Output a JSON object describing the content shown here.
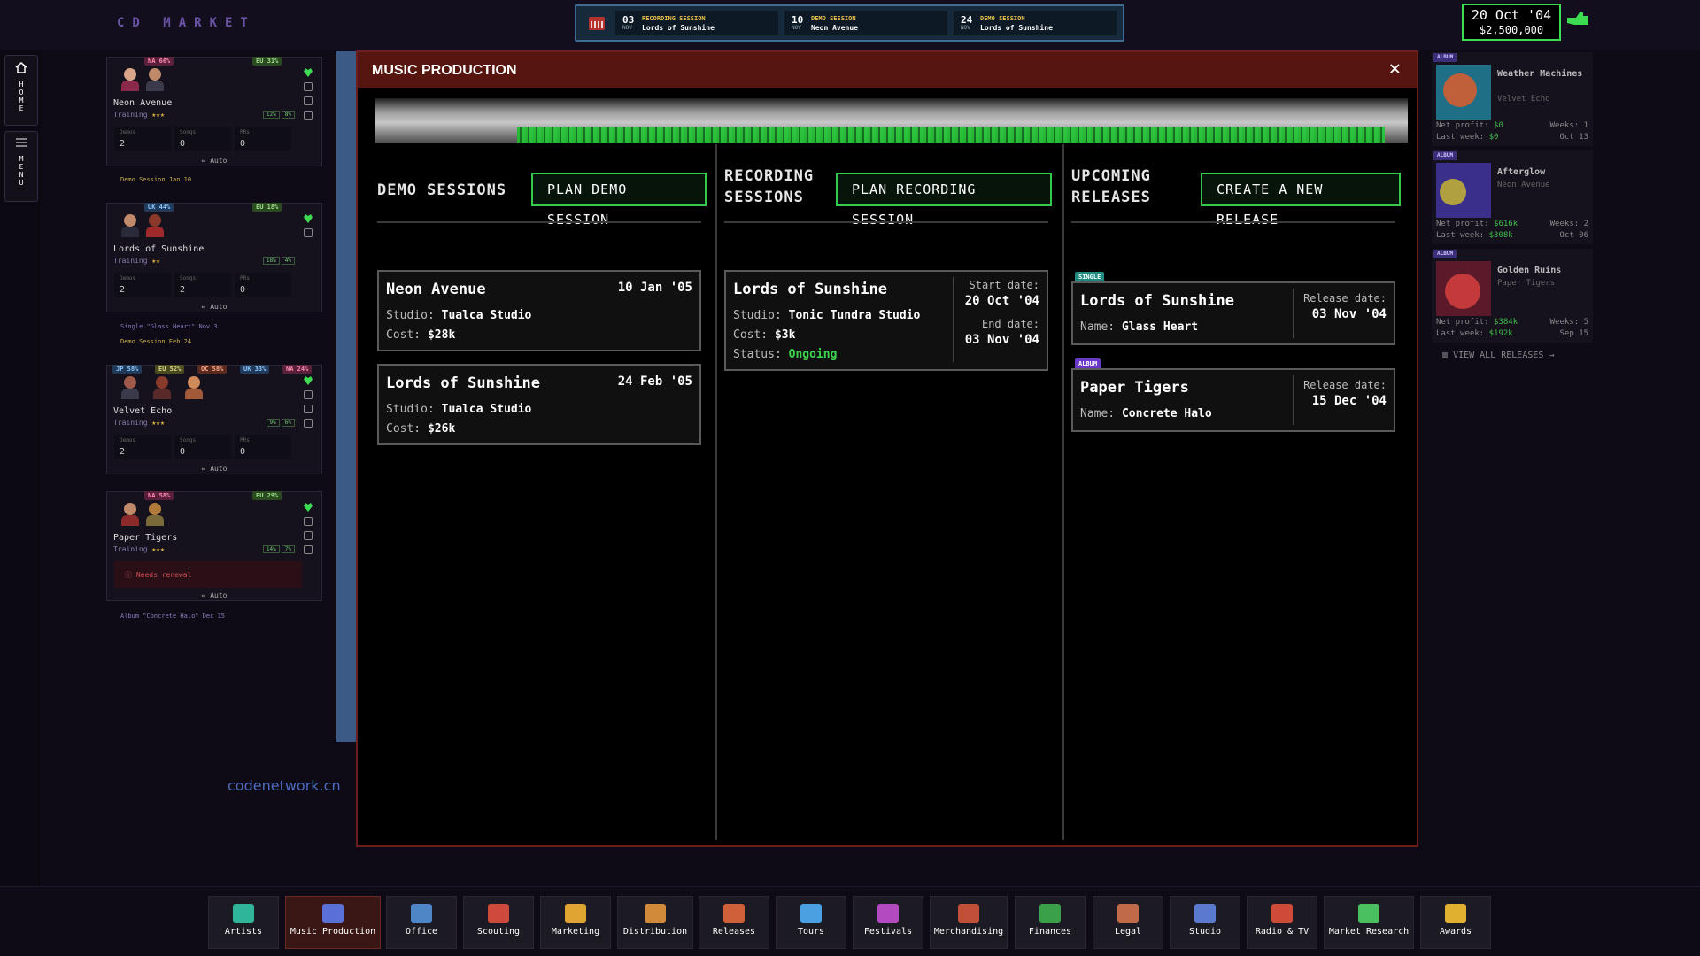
{
  "brand": "CD MARKET",
  "schedule": [
    {
      "day": "03",
      "month": "NOV",
      "type": "RECORDING SESSION",
      "name": "Lords of Sunshine"
    },
    {
      "day": "10",
      "month": "NOV",
      "type": "DEMO SESSION",
      "name": "Neon Avenue"
    },
    {
      "day": "24",
      "month": "NOV",
      "type": "DEMO SESSION",
      "name": "Lords of Sunshine"
    }
  ],
  "status": {
    "date": "20 Oct '04",
    "money": "$2,500,000"
  },
  "rail": {
    "home": "HOME",
    "menu": "MENU"
  },
  "artists": [
    {
      "name": "Neon Avenue",
      "training": "Training",
      "stars": "★★★",
      "tags": [
        "NA 66%",
        "EU 31%"
      ],
      "badges": [
        "12%",
        "8%"
      ],
      "stats": [
        {
          "k": "Demos",
          "v": "2"
        },
        {
          "k": "Songs",
          "v": "0"
        },
        {
          "k": "PRs",
          "v": "0"
        }
      ],
      "auto": "Auto",
      "notes": [
        "Demo Session Jan 10"
      ]
    },
    {
      "name": "Lords of Sunshine",
      "training": "Training",
      "stars": "★★",
      "tags": [
        "UK 44%",
        "EU 18%"
      ],
      "badges": [
        "18%",
        "4%"
      ],
      "stats": [
        {
          "k": "Demos",
          "v": "2"
        },
        {
          "k": "Songs",
          "v": "2"
        },
        {
          "k": "PRs",
          "v": "0"
        }
      ],
      "auto": "Auto",
      "notes": [
        "Single \"Glass Heart\" Nov 3",
        "Demo Session Feb 24"
      ]
    },
    {
      "name": "Velvet Echo",
      "training": "Training",
      "stars": "★★★",
      "tags": [
        "JP 58%",
        "EU 52%",
        "OC 58%",
        "UK 33%",
        "NA 24%"
      ],
      "badges": [
        "9%",
        "6%"
      ],
      "stats": [
        {
          "k": "Demos",
          "v": "2"
        },
        {
          "k": "Songs",
          "v": "0"
        },
        {
          "k": "PRs",
          "v": "0"
        }
      ],
      "auto": "Auto",
      "notes": []
    },
    {
      "name": "Paper Tigers",
      "training": "Training",
      "stars": "★★★",
      "tags": [
        "NA 58%",
        "EU 29%"
      ],
      "badges": [
        "14%",
        "7%"
      ],
      "renew": "Needs renewal",
      "auto": "Auto",
      "notes": [
        "Album \"Concrete Halo\" Dec 15"
      ]
    }
  ],
  "watermark": "codenetwork.cn",
  "modal": {
    "title": "MUSIC PRODUCTION",
    "close": "✕",
    "demo": {
      "title": "DEMO SESSIONS",
      "button": "PLAN DEMO SESSION",
      "items": [
        {
          "artist": "Neon Avenue",
          "date": "10 Jan '05",
          "studio_label": "Studio:",
          "studio": "Tualca Studio",
          "cost_label": "Cost:",
          "cost": "$28k"
        },
        {
          "artist": "Lords of Sunshine",
          "date": "24 Feb '05",
          "studio_label": "Studio:",
          "studio": "Tualca Studio",
          "cost_label": "Cost:",
          "cost": "$26k"
        }
      ]
    },
    "recording": {
      "title_line1": "RECORDING",
      "title_line2": "SESSIONS",
      "button": "PLAN RECORDING SESSION",
      "items": [
        {
          "artist": "Lords of Sunshine",
          "studio_label": "Studio:",
          "studio": "Tonic Tundra Studio",
          "cost_label": "Cost:",
          "cost": "$3k",
          "status_label": "Status:",
          "status": "Ongoing",
          "start_label": "Start date:",
          "start": "20 Oct '04",
          "end_label": "End date:",
          "end": "03 Nov '04"
        }
      ]
    },
    "releases": {
      "title_line1": "UPCOMING",
      "title_line2": "RELEASES",
      "button": "CREATE A NEW RELEASE",
      "items": [
        {
          "type": "SINGLE",
          "artist": "Lords of Sunshine",
          "name_label": "Name:",
          "name": "Glass Heart",
          "date_label": "Release date:",
          "date": "03 Nov '04"
        },
        {
          "type": "ALBUM",
          "artist": "Paper Tigers",
          "name_label": "Name:",
          "name": "Concrete Halo",
          "date_label": "Release date:",
          "date": "15 Dec '04"
        }
      ]
    }
  },
  "released": [
    {
      "tag": "ALBUM",
      "title": "Weather Machines",
      "artist": "Velvet Echo",
      "net_label": "Net profit:",
      "net": "$0",
      "weeks_label": "Weeks:",
      "weeks": "1",
      "last_label": "Last week:",
      "last": "$0",
      "date": "Oct 13",
      "colors": [
        "#1f6f86",
        "#c0603a"
      ]
    },
    {
      "tag": "ALBUM",
      "title": "Afterglow",
      "artist": "Neon Avenue",
      "net_label": "Net profit:",
      "net": "$616k",
      "weeks_label": "Weeks:",
      "weeks": "2",
      "last_label": "Last week:",
      "last": "$308k",
      "date": "Oct 06",
      "colors": [
        "#3a2f8a",
        "#b0a040"
      ]
    },
    {
      "tag": "ALBUM",
      "title": "Golden Ruins",
      "artist": "Paper Tigers",
      "net_label": "Net profit:",
      "net": "$384k",
      "weeks_label": "Weeks:",
      "weeks": "5",
      "last_label": "Last week:",
      "last": "$192k",
      "date": "Sep 15",
      "colors": [
        "#5a1a2a",
        "#c43a3a"
      ]
    }
  ],
  "view_all": "VIEW ALL RELEASES",
  "nav": [
    {
      "label": "Artists",
      "icon": "artists-icon",
      "color": "#2fb59a"
    },
    {
      "label": "Music Production",
      "icon": "music-production-icon",
      "color": "#5a6fd8"
    },
    {
      "label": "Office",
      "icon": "office-icon",
      "color": "#4f86c6"
    },
    {
      "label": "Scouting",
      "icon": "scouting-icon",
      "color": "#d0493d"
    },
    {
      "label": "Marketing",
      "icon": "marketing-icon",
      "color": "#e0a530"
    },
    {
      "label": "Distribution",
      "icon": "distribution-icon",
      "color": "#d08a3a"
    },
    {
      "label": "Releases",
      "icon": "releases-icon",
      "color": "#d0603a"
    },
    {
      "label": "Tours",
      "icon": "tours-icon",
      "color": "#4aa0e0"
    },
    {
      "label": "Festivals",
      "icon": "festivals-icon",
      "color": "#b34ac0"
    },
    {
      "label": "Merchandising",
      "icon": "merchandising-icon",
      "color": "#c0503a"
    },
    {
      "label": "Finances",
      "icon": "finances-icon",
      "color": "#3aa04a"
    },
    {
      "label": "Legal",
      "icon": "legal-icon",
      "color": "#c06a4a"
    },
    {
      "label": "Studio",
      "icon": "studio-icon",
      "color": "#5a7ad0"
    },
    {
      "label": "Radio & TV",
      "icon": "radio-tv-icon",
      "color": "#d04a3a"
    },
    {
      "label": "Market Research",
      "icon": "market-research-icon",
      "color": "#4ac060"
    },
    {
      "label": "Awards",
      "icon": "awards-icon",
      "color": "#e0b030"
    }
  ]
}
